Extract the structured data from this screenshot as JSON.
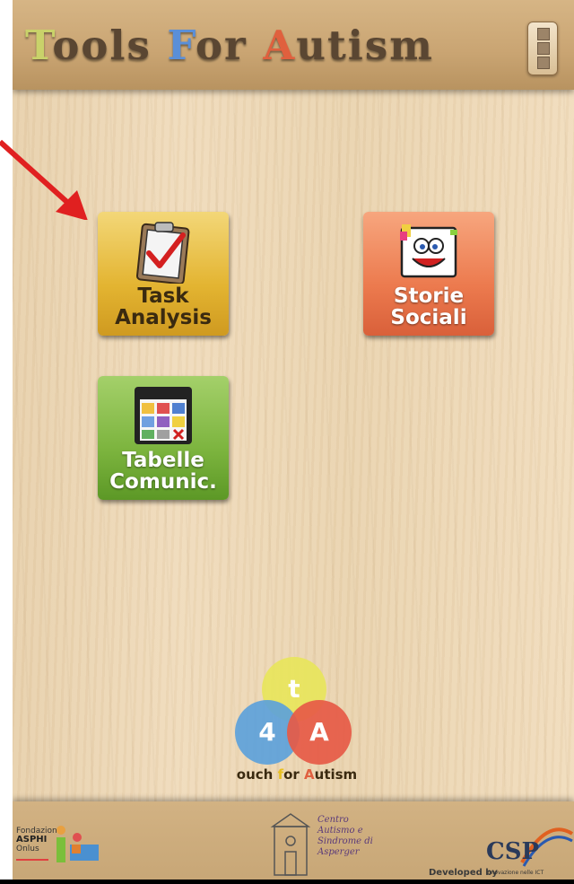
{
  "header": {
    "title_parts": [
      "T",
      "ools ",
      "F",
      "or ",
      "A",
      "utism"
    ],
    "menu_icon": "overflow-menu-icon"
  },
  "tiles": [
    {
      "id": "task",
      "line1": "Task",
      "line2": "Analysis",
      "icon": "clipboard-checkmark-icon",
      "color": "#e3b431"
    },
    {
      "id": "story",
      "line1": "Storie",
      "line2": "Sociali",
      "icon": "smiling-book-icon",
      "color": "#ec7a4e"
    },
    {
      "id": "table",
      "line1": "Tabelle",
      "line2": "Comunic.",
      "icon": "communication-board-icon",
      "color": "#7cb43e"
    }
  ],
  "logo": {
    "t": "t",
    "four": "4",
    "a": "A",
    "caption_parts": [
      "ouch ",
      "f",
      "or ",
      "A",
      "utism"
    ]
  },
  "footer": {
    "asphi_l1": "Fondazione",
    "asphi_l2": "ASPHI",
    "asphi_l3": "Onlus",
    "centro_l1": "Centro",
    "centro_l2": "Autismo e",
    "centro_l3": "Sindrome di",
    "centro_l4": "Asperger",
    "developed_by": "Developed by",
    "csp": "CSP",
    "csp_sub": "innovazione nelle ICT"
  },
  "annotation": {
    "type": "arrow",
    "color": "#e02020"
  }
}
